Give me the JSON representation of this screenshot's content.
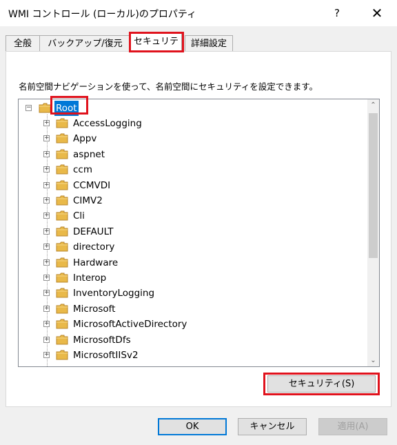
{
  "window": {
    "title": "WMI コントロール (ローカル)のプロパティ",
    "help_label": "?",
    "close_label": "✕"
  },
  "tabs": [
    {
      "label": "全般"
    },
    {
      "label": "バックアップ/復元"
    },
    {
      "label": "セキュリティ"
    },
    {
      "label": "詳細設定"
    }
  ],
  "active_tab": "セキュリティ",
  "description": "名前空間ナビゲーションを使って、名前空間にセキュリティを設定できます。",
  "tree": {
    "root": "Root",
    "children": [
      "AccessLogging",
      "Appv",
      "aspnet",
      "ccm",
      "CCMVDI",
      "CIMV2",
      "Cli",
      "DEFAULT",
      "directory",
      "Hardware",
      "Interop",
      "InventoryLogging",
      "Microsoft",
      "MicrosoftActiveDirectory",
      "MicrosoftDfs",
      "MicrosoftIISv2"
    ]
  },
  "buttons": {
    "security": "セキュリティ(S)",
    "ok": "OK",
    "cancel": "キャンセル",
    "apply": "適用(A)"
  },
  "colors": {
    "highlight_box": "#e0121c",
    "selection": "#0078d7"
  }
}
